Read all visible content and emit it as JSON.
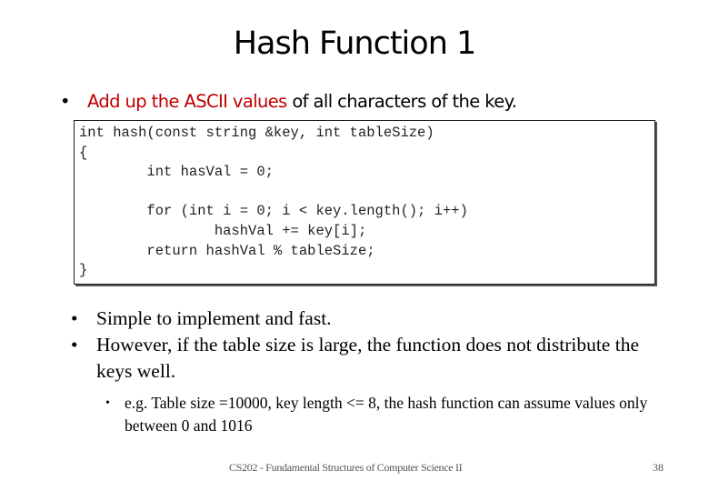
{
  "slide": {
    "title": "Hash Function 1",
    "main_bullet": {
      "bullet_glyph": "•",
      "highlight": "Add up the ASCII values",
      "rest": " of all  characters of the key.",
      "highlight_color": "#c00000"
    },
    "code_lines": [
      "int hash(const string &key, int tableSize)",
      "{",
      "        int hasVal = 0;",
      "",
      "        for (int i = 0; i < key.length(); i++)",
      "                hashVal += key[i];",
      "        return hashVal % tableSize;",
      "}"
    ],
    "bullets": [
      {
        "glyph": "•",
        "text": "Simple to implement and fast."
      },
      {
        "glyph": "•",
        "text": "However, if the table size is large, the function does not distribute the keys well."
      }
    ],
    "sub_bullets": [
      {
        "glyph": "•",
        "text": "e.g. Table size =10000, key length <= 8, the hash function can assume values only between 0 and 1016"
      }
    ],
    "footer": {
      "course": "CS202 - Fundamental Structures of Computer Science II",
      "page_number": "38"
    }
  }
}
